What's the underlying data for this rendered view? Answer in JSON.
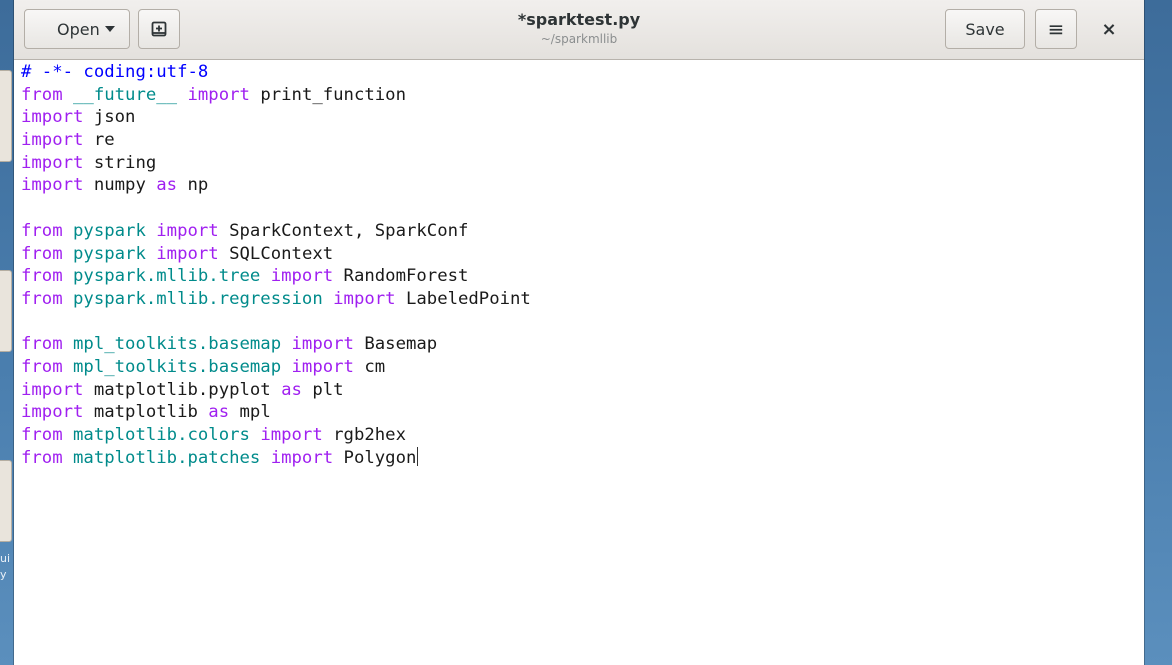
{
  "window": {
    "title": "*sparktest.py",
    "subtitle": "~/sparkmllib"
  },
  "headerbar": {
    "open_label": "Open",
    "save_label": "Save",
    "new_tab_icon": "new-document-icon",
    "menu_icon": "hamburger-menu-icon",
    "close_icon": "close-icon",
    "close_glyph": "×",
    "menu_glyph": "≡"
  },
  "desktop": {
    "partial_text_1": "ui",
    "partial_text_2": "y"
  },
  "colors": {
    "keyword": "#a020f0",
    "module": "#008b8b",
    "comment": "#0000ff",
    "text": "#1a1a1a"
  },
  "code": {
    "lines": [
      {
        "parts": [
          {
            "t": "# -*- coding:utf-8",
            "c": "cmt"
          }
        ]
      },
      {
        "parts": [
          {
            "t": "from",
            "c": "kw"
          },
          {
            "t": " "
          },
          {
            "t": "__future__",
            "c": "mod"
          },
          {
            "t": " "
          },
          {
            "t": "import",
            "c": "kw"
          },
          {
            "t": " print_function"
          }
        ]
      },
      {
        "parts": [
          {
            "t": "import",
            "c": "kw"
          },
          {
            "t": " json"
          }
        ]
      },
      {
        "parts": [
          {
            "t": "import",
            "c": "kw"
          },
          {
            "t": " re"
          }
        ]
      },
      {
        "parts": [
          {
            "t": "import",
            "c": "kw"
          },
          {
            "t": " string"
          }
        ]
      },
      {
        "parts": [
          {
            "t": "import",
            "c": "kw"
          },
          {
            "t": " numpy "
          },
          {
            "t": "as",
            "c": "kw"
          },
          {
            "t": " np"
          }
        ]
      },
      {
        "parts": []
      },
      {
        "parts": [
          {
            "t": "from",
            "c": "kw"
          },
          {
            "t": " "
          },
          {
            "t": "pyspark",
            "c": "mod"
          },
          {
            "t": " "
          },
          {
            "t": "import",
            "c": "kw"
          },
          {
            "t": " SparkContext, SparkConf"
          }
        ]
      },
      {
        "parts": [
          {
            "t": "from",
            "c": "kw"
          },
          {
            "t": " "
          },
          {
            "t": "pyspark",
            "c": "mod"
          },
          {
            "t": " "
          },
          {
            "t": "import",
            "c": "kw"
          },
          {
            "t": " SQLContext"
          }
        ]
      },
      {
        "parts": [
          {
            "t": "from",
            "c": "kw"
          },
          {
            "t": " "
          },
          {
            "t": "pyspark.mllib.tree",
            "c": "mod"
          },
          {
            "t": " "
          },
          {
            "t": "import",
            "c": "kw"
          },
          {
            "t": " RandomForest"
          }
        ]
      },
      {
        "parts": [
          {
            "t": "from",
            "c": "kw"
          },
          {
            "t": " "
          },
          {
            "t": "pyspark.mllib.regression",
            "c": "mod"
          },
          {
            "t": " "
          },
          {
            "t": "import",
            "c": "kw"
          },
          {
            "t": " LabeledPoint"
          }
        ]
      },
      {
        "parts": []
      },
      {
        "parts": [
          {
            "t": "from",
            "c": "kw"
          },
          {
            "t": " "
          },
          {
            "t": "mpl_toolkits.basemap",
            "c": "mod"
          },
          {
            "t": " "
          },
          {
            "t": "import",
            "c": "kw"
          },
          {
            "t": " Basemap"
          }
        ]
      },
      {
        "parts": [
          {
            "t": "from",
            "c": "kw"
          },
          {
            "t": " "
          },
          {
            "t": "mpl_toolkits.basemap",
            "c": "mod"
          },
          {
            "t": " "
          },
          {
            "t": "import",
            "c": "kw"
          },
          {
            "t": " cm"
          }
        ]
      },
      {
        "parts": [
          {
            "t": "import",
            "c": "kw"
          },
          {
            "t": " matplotlib.pyplot "
          },
          {
            "t": "as",
            "c": "kw"
          },
          {
            "t": " plt"
          }
        ]
      },
      {
        "parts": [
          {
            "t": "import",
            "c": "kw"
          },
          {
            "t": " matplotlib "
          },
          {
            "t": "as",
            "c": "kw"
          },
          {
            "t": " mpl"
          }
        ]
      },
      {
        "parts": [
          {
            "t": "from",
            "c": "kw"
          },
          {
            "t": " "
          },
          {
            "t": "matplotlib.colors",
            "c": "mod"
          },
          {
            "t": " "
          },
          {
            "t": "import",
            "c": "kw"
          },
          {
            "t": " rgb2hex"
          }
        ]
      },
      {
        "parts": [
          {
            "t": "from",
            "c": "kw"
          },
          {
            "t": " "
          },
          {
            "t": "matplotlib.patches",
            "c": "mod"
          },
          {
            "t": " "
          },
          {
            "t": "import",
            "c": "kw"
          },
          {
            "t": " Polygon"
          }
        ],
        "cursor": true
      }
    ]
  }
}
